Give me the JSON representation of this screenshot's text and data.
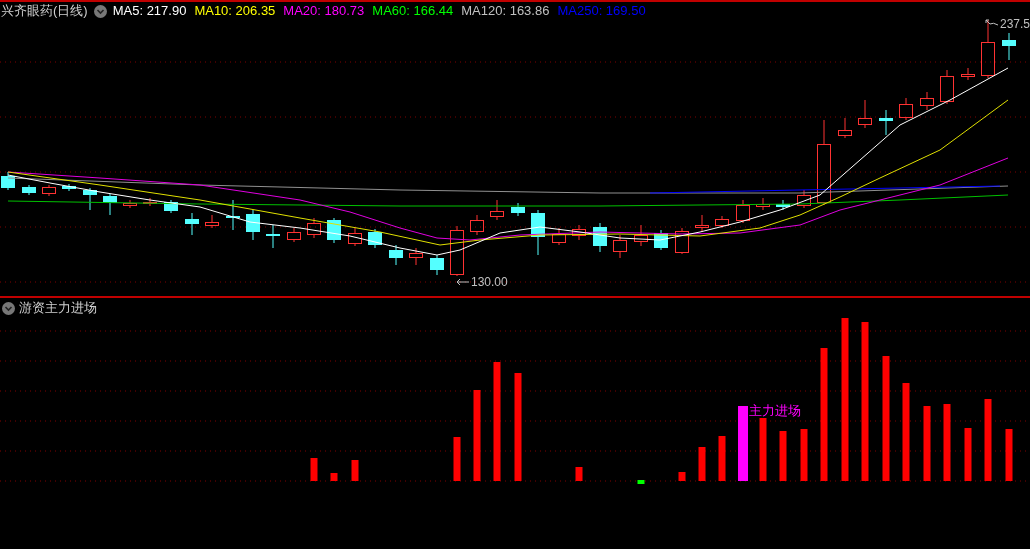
{
  "price_panel": {
    "title": "兴齐眼药(日线)",
    "moving_averages": [
      {
        "text": "MA5: 217.90",
        "color": "#ffffff"
      },
      {
        "text": "MA10: 206.35",
        "color": "#ffff00"
      },
      {
        "text": "MA20: 180.73",
        "color": "#ff00ff"
      },
      {
        "text": "MA60: 166.44",
        "color": "#00ff00"
      },
      {
        "text": "MA120: 163.86",
        "color": "#c0c0c0"
      },
      {
        "text": "MA250: 169.50",
        "color": "#0000ff"
      }
    ],
    "high_label": "237.5",
    "low_label": "130.00"
  },
  "indicator_panel": {
    "title": "游资主力进场",
    "signal_label": "主力进场"
  }
}
